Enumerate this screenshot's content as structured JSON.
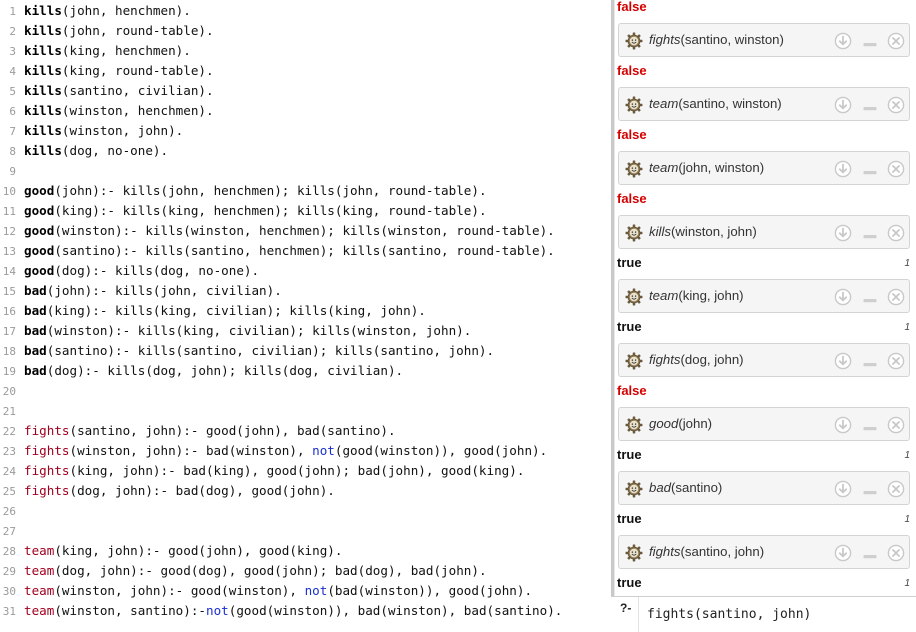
{
  "editor": {
    "lines": [
      {
        "n": "1",
        "tokens": [
          {
            "t": "kills",
            "c": "ps"
          },
          {
            "t": "(john, henchmen).",
            "c": "code"
          }
        ]
      },
      {
        "n": "2",
        "tokens": [
          {
            "t": "kills",
            "c": "ps"
          },
          {
            "t": "(john, round-table).",
            "c": "code"
          }
        ]
      },
      {
        "n": "3",
        "tokens": [
          {
            "t": "kills",
            "c": "ps"
          },
          {
            "t": "(king, henchmen).",
            "c": "code"
          }
        ]
      },
      {
        "n": "4",
        "tokens": [
          {
            "t": "kills",
            "c": "ps"
          },
          {
            "t": "(king, round-table).",
            "c": "code"
          }
        ]
      },
      {
        "n": "5",
        "tokens": [
          {
            "t": "kills",
            "c": "ps"
          },
          {
            "t": "(santino, civilian).",
            "c": "code"
          }
        ]
      },
      {
        "n": "6",
        "tokens": [
          {
            "t": "kills",
            "c": "ps"
          },
          {
            "t": "(winston, henchmen).",
            "c": "code"
          }
        ]
      },
      {
        "n": "7",
        "tokens": [
          {
            "t": "kills",
            "c": "ps"
          },
          {
            "t": "(winston, john).",
            "c": "code"
          }
        ]
      },
      {
        "n": "8",
        "tokens": [
          {
            "t": "kills",
            "c": "ps"
          },
          {
            "t": "(dog, no-one).",
            "c": "code"
          }
        ]
      },
      {
        "n": "9",
        "tokens": []
      },
      {
        "n": "10",
        "tokens": [
          {
            "t": "good",
            "c": "ps"
          },
          {
            "t": "(john):- kills(john, henchmen); kills(john, round-table).",
            "c": "code"
          }
        ]
      },
      {
        "n": "11",
        "tokens": [
          {
            "t": "good",
            "c": "ps"
          },
          {
            "t": "(king):- kills(king, henchmen); kills(king, round-table).",
            "c": "code"
          }
        ]
      },
      {
        "n": "12",
        "tokens": [
          {
            "t": "good",
            "c": "ps"
          },
          {
            "t": "(winston):- kills(winston, henchmen); kills(winston, round-table).",
            "c": "code"
          }
        ]
      },
      {
        "n": "13",
        "tokens": [
          {
            "t": "good",
            "c": "ps"
          },
          {
            "t": "(santino):- kills(santino, henchmen); kills(santino, round-table).",
            "c": "code"
          }
        ]
      },
      {
        "n": "14",
        "tokens": [
          {
            "t": "good",
            "c": "ps"
          },
          {
            "t": "(dog):- kills(dog, no-one).",
            "c": "code"
          }
        ]
      },
      {
        "n": "15",
        "tokens": [
          {
            "t": "bad",
            "c": "ps"
          },
          {
            "t": "(john):- kills(john, civilian).",
            "c": "code"
          }
        ]
      },
      {
        "n": "16",
        "tokens": [
          {
            "t": "bad",
            "c": "ps"
          },
          {
            "t": "(king):- kills(king, civilian); kills(king, john).",
            "c": "code"
          }
        ]
      },
      {
        "n": "17",
        "tokens": [
          {
            "t": "bad",
            "c": "ps"
          },
          {
            "t": "(winston):- kills(king, civilian); kills(winston, john).",
            "c": "code"
          }
        ]
      },
      {
        "n": "18",
        "tokens": [
          {
            "t": "bad",
            "c": "ps"
          },
          {
            "t": "(santino):- kills(santino, civilian); kills(santino, john).",
            "c": "code"
          }
        ]
      },
      {
        "n": "19",
        "tokens": [
          {
            "t": "bad",
            "c": "ps"
          },
          {
            "t": "(dog):- kills(dog, john); kills(dog, civilian).",
            "c": "code"
          }
        ]
      },
      {
        "n": "20",
        "tokens": []
      },
      {
        "n": "21",
        "tokens": []
      },
      {
        "n": "22",
        "tokens": [
          {
            "t": "fights",
            "c": "h"
          },
          {
            "t": "(santino, john):- good(john), bad(santino).",
            "c": "code"
          }
        ]
      },
      {
        "n": "23",
        "tokens": [
          {
            "t": "fights",
            "c": "h"
          },
          {
            "t": "(winston, john):- bad(winston), ",
            "c": "code"
          },
          {
            "t": "not",
            "c": "kw"
          },
          {
            "t": "(good(winston)), good(john).",
            "c": "code"
          }
        ]
      },
      {
        "n": "24",
        "tokens": [
          {
            "t": "fights",
            "c": "h"
          },
          {
            "t": "(king, john):- bad(king), good(john); bad(john), good(king).",
            "c": "code"
          }
        ]
      },
      {
        "n": "25",
        "tokens": [
          {
            "t": "fights",
            "c": "h"
          },
          {
            "t": "(dog, john):- bad(dog), good(john).",
            "c": "code"
          }
        ]
      },
      {
        "n": "26",
        "tokens": []
      },
      {
        "n": "27",
        "tokens": []
      },
      {
        "n": "28",
        "tokens": [
          {
            "t": "team",
            "c": "h"
          },
          {
            "t": "(king, john):- good(john), good(king).",
            "c": "code"
          }
        ]
      },
      {
        "n": "29",
        "tokens": [
          {
            "t": "team",
            "c": "h"
          },
          {
            "t": "(dog, john):- good(dog), good(john); bad(dog), bad(john).",
            "c": "code"
          }
        ]
      },
      {
        "n": "30",
        "tokens": [
          {
            "t": "team",
            "c": "h"
          },
          {
            "t": "(winston, john):- good(winston), ",
            "c": "code"
          },
          {
            "t": "not",
            "c": "kw"
          },
          {
            "t": "(bad(winston)), good(john).",
            "c": "code"
          }
        ]
      },
      {
        "n": "31",
        "tokens": [
          {
            "t": "team",
            "c": "h"
          },
          {
            "t": "(winston, santino):-",
            "c": "code"
          },
          {
            "t": "not",
            "c": "kw"
          },
          {
            "t": "(good(winston)), bad(winston), bad(santino).",
            "c": "code"
          }
        ]
      }
    ]
  },
  "results": {
    "top_answer": "false",
    "queries": [
      {
        "pred": "fights",
        "args": "(santino, winston)",
        "answer": "false",
        "count": ""
      },
      {
        "pred": "team",
        "args": "(santino, winston)",
        "answer": "false",
        "count": ""
      },
      {
        "pred": "team",
        "args": "(john, winston)",
        "answer": "false",
        "count": ""
      },
      {
        "pred": "kills",
        "args": "(winston, john)",
        "answer": "true",
        "count": "1"
      },
      {
        "pred": "team",
        "args": "(king, john)",
        "answer": "true",
        "count": "1"
      },
      {
        "pred": "fights",
        "args": "(dog, john)",
        "answer": "false",
        "count": ""
      },
      {
        "pred": "good",
        "args": "(john)",
        "answer": "true",
        "count": "1"
      },
      {
        "pred": "bad",
        "args": "(santino)",
        "answer": "true",
        "count": "1"
      },
      {
        "pred": "fights",
        "args": "(santino, john)",
        "answer": "true",
        "count": "1"
      }
    ]
  },
  "prompt": {
    "symbol": "?-",
    "value": "fights(santino, john)"
  },
  "icons": {
    "query_icon": "gear-smiley-icon",
    "next_icon": "arrow-down-circle-icon",
    "minimize_icon": "minus-icon",
    "close_icon": "close-circle-icon"
  },
  "colors": {
    "false": "#d40000",
    "true": "#111111",
    "head_predicate": "#a0001f",
    "keyword_not": "#1a2fd0"
  }
}
